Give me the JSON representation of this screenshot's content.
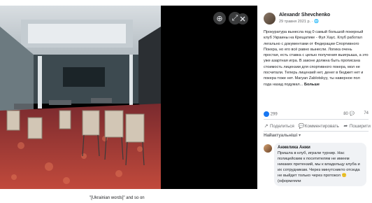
{
  "viewer": {
    "controls": [
      "zoom-in-icon",
      "expand-icon",
      "close-icon"
    ]
  },
  "post": {
    "author": "Alexandr Shevchenko",
    "date": "29 травня 2021 р. · 🌐",
    "text": "Прокуратура вынесла под 0 самый большой покерный клуб Украины на Крещатике - Фул Хаус. Клуб работал легально с документами от Федерации Спортивного Покера, но его всё равно вынесли. Логика очень простая, есть ставка с целью получения выигрыша, а это уже азартная игра. В законе должна быть прописана стоимость лицензии для спортивного покера, мол не посчитали. Теперь лицензий нет, денег в бюджет нет и покера тоже нет. Maryan Zablotskyy, ты наверное пол года назад подумал...",
    "more_label": "Больше",
    "reactions_count": "299",
    "comments_count": "80 💬",
    "shares_count": "74",
    "actions": {
      "share": "Поделиться",
      "comment": "Комментировать",
      "send": "Поширити"
    },
    "sort_label": "Найактуальніші ▾"
  },
  "comment": {
    "name": "Анжелика Анжи",
    "text": "Пришла в клуб, играли турнир. Нас полицейским к посетителям не имеем никаких претензий, мы к владельцу клуба и их сотрудникам. Через минутсникто отсюда не выйдет только через протокол 🙁 (оформляли"
  },
  "caption": "\"[Ukrainian words]\" and so on"
}
